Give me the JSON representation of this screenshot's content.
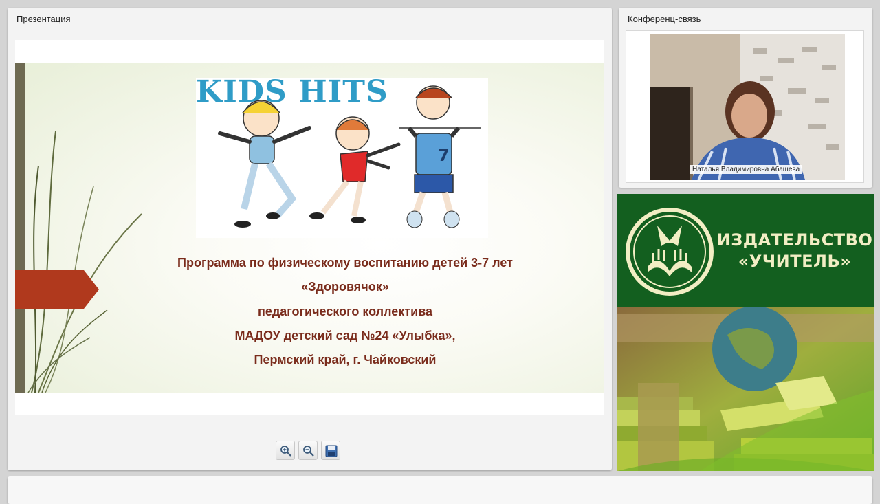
{
  "presentation": {
    "title": "Презентация",
    "slide": {
      "image_title": "KIDS HITS",
      "lines": [
        "Программа по физическому воспитанию детей 3-7 лет",
        "«Здоровячок»",
        "педагогического коллектива",
        "МАДОУ детский сад №24 «Улыбка»,",
        "Пермский край, г. Чайковский"
      ]
    },
    "toolbar": {
      "zoom_in_icon": "zoom-in-icon",
      "zoom_out_icon": "zoom-out-icon",
      "save_icon": "save-icon"
    }
  },
  "conference": {
    "title": "Конференц-связь",
    "participant_name": "Наталья Владимировна Абашева"
  },
  "publisher": {
    "name_line1": "ИЗДАТЕЛЬСТВО",
    "name_line2": "«УЧИТЕЛЬ»"
  },
  "colors": {
    "slide_text": "#7a2c1c",
    "kids_title": "#2f9cc7",
    "publisher_green": "#135f1f",
    "arrow": "#b0391d"
  }
}
